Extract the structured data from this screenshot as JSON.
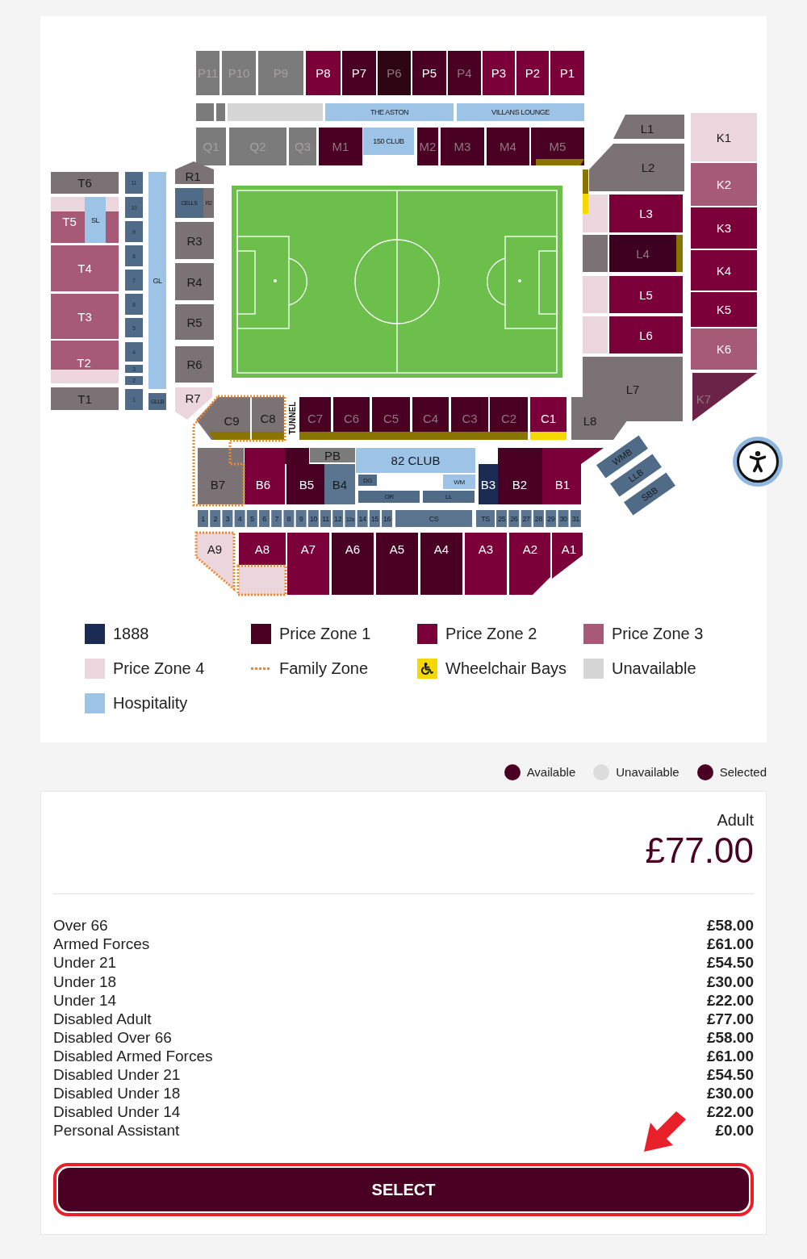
{
  "stadium_map": {
    "sections": [
      {
        "label": "P11",
        "color": "#7b7b7b",
        "dimmed": true
      },
      {
        "label": "P10",
        "color": "#7b7b7b",
        "dimmed": true
      },
      {
        "label": "P9",
        "color": "#7b7b7b",
        "dimmed": true
      },
      {
        "label": "P8",
        "color": "#7b0039",
        "dimmed": false
      },
      {
        "label": "P7",
        "color": "#4a0022",
        "dimmed": false
      },
      {
        "label": "P6",
        "color": "#2e0613",
        "dimmed": true
      },
      {
        "label": "P5",
        "color": "#4a0022",
        "dimmed": false
      },
      {
        "label": "P4",
        "color": "#4a0022",
        "dimmed": true
      },
      {
        "label": "P3",
        "color": "#7b0039",
        "dimmed": false
      },
      {
        "label": "P2",
        "color": "#7b0039",
        "dimmed": false
      },
      {
        "label": "P1",
        "color": "#7b0039",
        "dimmed": false
      },
      {
        "label": "THE ASTON",
        "color": "#9dc3e6",
        "dimmed": false
      },
      {
        "label": "VILLANS LOUNGE",
        "color": "#9dc3e6",
        "dimmed": false
      },
      {
        "label": "Q1",
        "color": "#7b7b7b",
        "dimmed": true
      },
      {
        "label": "Q2",
        "color": "#7b7b7b",
        "dimmed": true
      },
      {
        "label": "Q3",
        "color": "#7b7b7b",
        "dimmed": true
      },
      {
        "label": "M1",
        "color": "#4a0022",
        "dimmed": true
      },
      {
        "label": "150 CLUB",
        "color": "#9dc3e6",
        "dimmed": false
      },
      {
        "label": "M2",
        "color": "#4a0022",
        "dimmed": true
      },
      {
        "label": "M3",
        "color": "#4a0022",
        "dimmed": true
      },
      {
        "label": "M4",
        "color": "#4a0022",
        "dimmed": true
      },
      {
        "label": "M5",
        "color": "#4a0022",
        "dimmed": true
      },
      {
        "label": "T6",
        "color": "#7a7274",
        "dimmed": false
      },
      {
        "label": "T5",
        "color": "#a65a75",
        "dimmed": false
      },
      {
        "label": "SL",
        "color": "#9dc3e6",
        "dimmed": false
      },
      {
        "label": "T4",
        "color": "#a65a75",
        "dimmed": false
      },
      {
        "label": "T3",
        "color": "#a65a75",
        "dimmed": false
      },
      {
        "label": "T2",
        "color": "#a65a75",
        "dimmed": false
      },
      {
        "label": "T1",
        "color": "#7a7274",
        "dimmed": false
      },
      {
        "label": "GL",
        "color": "#9dc3e6",
        "dimmed": false
      },
      {
        "label": "GLLB",
        "color": "#4f6b88",
        "dimmed": false
      },
      {
        "label": "R1",
        "color": "#7a7274",
        "dimmed": false
      },
      {
        "label": "CELLS",
        "color": "#4f6b88",
        "dimmed": false
      },
      {
        "label": "R2",
        "color": "#7a7274",
        "dimmed": false
      },
      {
        "label": "R3",
        "color": "#7a7274",
        "dimmed": false
      },
      {
        "label": "R4",
        "color": "#7a7274",
        "dimmed": false
      },
      {
        "label": "R5",
        "color": "#7a7274",
        "dimmed": false
      },
      {
        "label": "R6",
        "color": "#7a7274",
        "dimmed": false
      },
      {
        "label": "R7",
        "color": "#ecd6dd",
        "dimmed": false
      },
      {
        "label": "L1",
        "color": "#7a7274",
        "dimmed": false
      },
      {
        "label": "L2",
        "color": "#7a7274",
        "dimmed": false
      },
      {
        "label": "L3",
        "color": "#7b0039",
        "dimmed": false
      },
      {
        "label": "L4",
        "color": "#3d0020",
        "dimmed": true
      },
      {
        "label": "L5",
        "color": "#7b0039",
        "dimmed": false
      },
      {
        "label": "L6",
        "color": "#7b0039",
        "dimmed": false
      },
      {
        "label": "L7",
        "color": "#7a7274",
        "dimmed": false
      },
      {
        "label": "L8",
        "color": "#7a7274",
        "dimmed": false
      },
      {
        "label": "K1",
        "color": "#ecd6dd",
        "dimmed": false
      },
      {
        "label": "K2",
        "color": "#a65a75",
        "dimmed": false
      },
      {
        "label": "K3",
        "color": "#7b0039",
        "dimmed": false
      },
      {
        "label": "K4",
        "color": "#7b0039",
        "dimmed": false
      },
      {
        "label": "K5",
        "color": "#7b0039",
        "dimmed": false
      },
      {
        "label": "K6",
        "color": "#a65a75",
        "dimmed": false
      },
      {
        "label": "K7",
        "color": "#6b2447",
        "dimmed": true
      },
      {
        "label": "C9",
        "color": "#7a7274",
        "dimmed": false
      },
      {
        "label": "C8",
        "color": "#7a7274",
        "dimmed": false
      },
      {
        "label": "C7",
        "color": "#4a0022",
        "dimmed": true
      },
      {
        "label": "C6",
        "color": "#4a0022",
        "dimmed": true
      },
      {
        "label": "C5",
        "color": "#4a0022",
        "dimmed": true
      },
      {
        "label": "C4",
        "color": "#4a0022",
        "dimmed": true
      },
      {
        "label": "C3",
        "color": "#4a0022",
        "dimmed": true
      },
      {
        "label": "C2",
        "color": "#4a0022",
        "dimmed": true
      },
      {
        "label": "C1",
        "color": "#7b0039",
        "dimmed": false
      },
      {
        "label": "B7",
        "color": "#7a7274",
        "dimmed": false
      },
      {
        "label": "B6",
        "color": "#7b0039",
        "dimmed": false
      },
      {
        "label": "B5",
        "color": "#4a0022",
        "dimmed": false
      },
      {
        "label": "PB",
        "color": "#7b7b7b",
        "dimmed": false
      },
      {
        "label": "B4",
        "color": "#5b7591",
        "dimmed": false
      },
      {
        "label": "82 CLUB",
        "color": "#9dc3e6",
        "dimmed": false
      },
      {
        "label": "DG",
        "color": "#4f6b88",
        "dimmed": false
      },
      {
        "label": "OR",
        "color": "#4f6b88",
        "dimmed": false
      },
      {
        "label": "LL",
        "color": "#4f6b88",
        "dimmed": false
      },
      {
        "label": "WM",
        "color": "#9dc3e6",
        "dimmed": false
      },
      {
        "label": "B3",
        "color": "#1c2b54",
        "dimmed": false
      },
      {
        "label": "B2",
        "color": "#4a0022",
        "dimmed": false
      },
      {
        "label": "B1",
        "color": "#7b0039",
        "dimmed": false
      },
      {
        "label": "WMB",
        "color": "#4f6b88",
        "dimmed": false
      },
      {
        "label": "LLB",
        "color": "#4f6b88",
        "dimmed": false
      },
      {
        "label": "SBB",
        "color": "#4f6b88",
        "dimmed": false
      },
      {
        "label": "A9",
        "color": "#ecd6dd",
        "dimmed": false
      },
      {
        "label": "A8",
        "color": "#7b0039",
        "dimmed": false
      },
      {
        "label": "A7",
        "color": "#7b0039",
        "dimmed": false
      },
      {
        "label": "A6",
        "color": "#4a0022",
        "dimmed": false
      },
      {
        "label": "A5",
        "color": "#4a0022",
        "dimmed": false
      },
      {
        "label": "A4",
        "color": "#4a0022",
        "dimmed": false
      },
      {
        "label": "A3",
        "color": "#7b0039",
        "dimmed": false
      },
      {
        "label": "A2",
        "color": "#7b0039",
        "dimmed": false
      },
      {
        "label": "A1",
        "color": "#7b0039",
        "dimmed": false
      }
    ],
    "tunnel_label": "TUNNEL",
    "left_boxes": [
      "11",
      "10",
      "9",
      "8",
      "7",
      "6",
      "5",
      "4",
      "3",
      "2",
      "1"
    ],
    "lower_boxes": [
      "1",
      "2",
      "3",
      "4",
      "5",
      "6",
      "7",
      "8",
      "9",
      "10",
      "11",
      "12",
      "12a",
      "14",
      "15",
      "16",
      "CS",
      "TS",
      "25",
      "26",
      "27",
      "28",
      "29",
      "30",
      "31"
    ]
  },
  "legend": [
    {
      "label": "1888",
      "kind": "swatch",
      "color": "#1c2b54"
    },
    {
      "label": "Price Zone 1",
      "kind": "swatch",
      "color": "#4a0022"
    },
    {
      "label": "Price Zone 2",
      "kind": "swatch",
      "color": "#7b0039"
    },
    {
      "label": "Price Zone 3",
      "kind": "swatch",
      "color": "#a65a75"
    },
    {
      "label": "Price Zone 4",
      "kind": "swatch",
      "color": "#ecd6dd"
    },
    {
      "label": "Family Zone",
      "kind": "dotted",
      "color": "#f0892b"
    },
    {
      "label": "Wheelchair Bays",
      "kind": "wheelchair",
      "color": "#f5d800"
    },
    {
      "label": "Unavailable",
      "kind": "swatch",
      "color": "#d6d6d6"
    },
    {
      "label": "Hospitality",
      "kind": "swatch",
      "color": "#9dc3e6"
    }
  ],
  "seat_key": [
    {
      "label": "Available",
      "color": "#4a0022"
    },
    {
      "label": "Unavailable",
      "color": "#dcdcdc"
    },
    {
      "label": "Selected",
      "color": "#4a0022"
    }
  ],
  "ticket": {
    "type": "Adult",
    "price": "£77.00",
    "prices": [
      {
        "name": "Over 66",
        "price": "£58.00"
      },
      {
        "name": "Armed Forces",
        "price": "£61.00"
      },
      {
        "name": "Under 21",
        "price": "£54.50"
      },
      {
        "name": "Under 18",
        "price": "£30.00"
      },
      {
        "name": "Under 14",
        "price": "£22.00"
      },
      {
        "name": "Disabled Adult",
        "price": "£77.00"
      },
      {
        "name": "Disabled Over 66",
        "price": "£58.00"
      },
      {
        "name": "Disabled Armed Forces",
        "price": "£61.00"
      },
      {
        "name": "Disabled Under 21",
        "price": "£54.50"
      },
      {
        "name": "Disabled Under 18",
        "price": "£30.00"
      },
      {
        "name": "Disabled Under 14",
        "price": "£22.00"
      },
      {
        "name": "Personal Assistant",
        "price": "£0.00"
      }
    ],
    "button": "SELECT"
  }
}
